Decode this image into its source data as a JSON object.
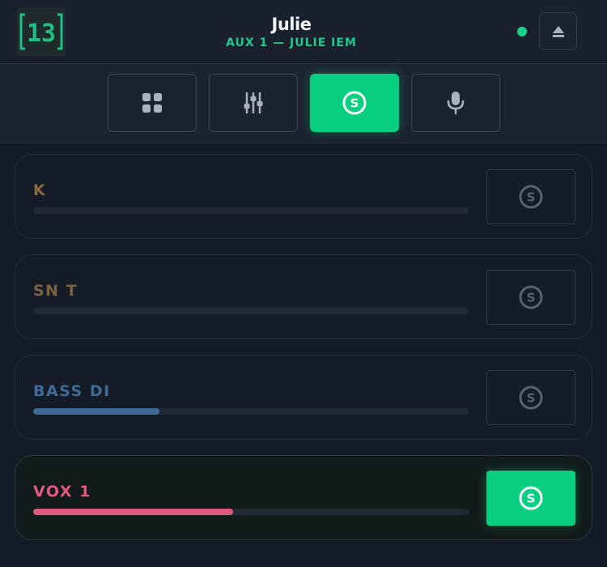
{
  "header": {
    "logo_text": "13",
    "title": "Julie",
    "subtitle": "AUX 1 — JULIE IEM",
    "status_color": "#1ad38a",
    "eject_icon": "eject-icon"
  },
  "tabs": [
    {
      "icon": "grid-icon",
      "active": false
    },
    {
      "icon": "sliders-icon",
      "active": false
    },
    {
      "icon": "solo-icon",
      "active": true
    },
    {
      "icon": "microphone-icon",
      "active": false
    }
  ],
  "channels": [
    {
      "name": "K",
      "color": "#8a6a3c",
      "level": 0,
      "solo": false
    },
    {
      "name": "SN T",
      "color": "#7a6242",
      "level": 0,
      "solo": false
    },
    {
      "name": "BASS DI",
      "color": "#3f6a96",
      "level": 0.29,
      "solo": false
    },
    {
      "name": "VOX 1",
      "color": "#e05a7c",
      "level": 0.46,
      "solo": true
    }
  ],
  "colors": {
    "accent": "#06cf7f",
    "background": "#151b26"
  }
}
